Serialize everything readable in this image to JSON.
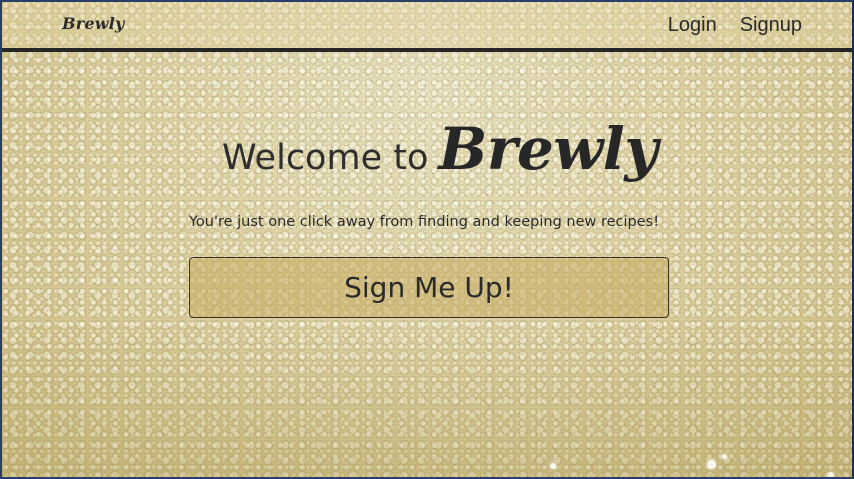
{
  "navbar": {
    "brand": "Brewly",
    "links": [
      {
        "label": "Login"
      },
      {
        "label": "Signup"
      }
    ]
  },
  "hero": {
    "title_prefix": "Welcome to",
    "title_brand": "Brewly",
    "tagline": "You're just one click away from finding and keeping new recipes!",
    "cta_label": "Sign Me Up!"
  }
}
